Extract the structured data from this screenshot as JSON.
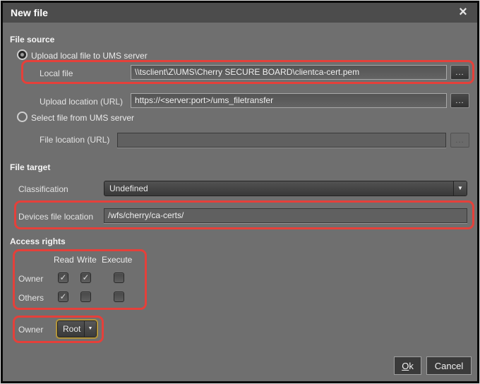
{
  "window": {
    "title": "New file",
    "close_glyph": "×"
  },
  "icons": {
    "ellipsis": "...",
    "check": "✓",
    "dropdown_arrow": "▼"
  },
  "sections": {
    "file_source": {
      "heading": "File source",
      "radio_upload": {
        "label": "Upload local file to UMS server",
        "selected": true
      },
      "local_file": {
        "label": "Local file",
        "value": "\\\\tsclient\\Z\\UMS\\Cherry SECURE BOARD\\clientca-cert.pem"
      },
      "upload_location": {
        "label": "Upload location (URL)",
        "value": "https://<server:port>/ums_filetransfer"
      },
      "radio_select": {
        "label": "Select file from UMS server",
        "selected": false
      },
      "file_location": {
        "label": "File location (URL)",
        "value": ""
      }
    },
    "file_target": {
      "heading": "File target",
      "classification": {
        "label": "Classification",
        "value": "Undefined"
      },
      "devices_file_location": {
        "label": "Devices file location",
        "value": "/wfs/cherry/ca-certs/"
      }
    },
    "access_rights": {
      "heading": "Access rights",
      "columns": [
        "Read",
        "Write",
        "Execute"
      ],
      "rows": [
        {
          "label": "Owner",
          "read": true,
          "write": true,
          "execute": false
        },
        {
          "label": "Others",
          "read": true,
          "write": false,
          "execute": false
        }
      ],
      "owner": {
        "label": "Owner",
        "value": "Root"
      }
    }
  },
  "buttons": {
    "ok": {
      "accel": "O",
      "rest": "k"
    },
    "cancel": "Cancel"
  },
  "colors": {
    "highlight": "#e5403a",
    "focus_ring": "#b2943a",
    "titlebar": "#4c4c4c",
    "dialog_bg": "#6f6f6f"
  }
}
